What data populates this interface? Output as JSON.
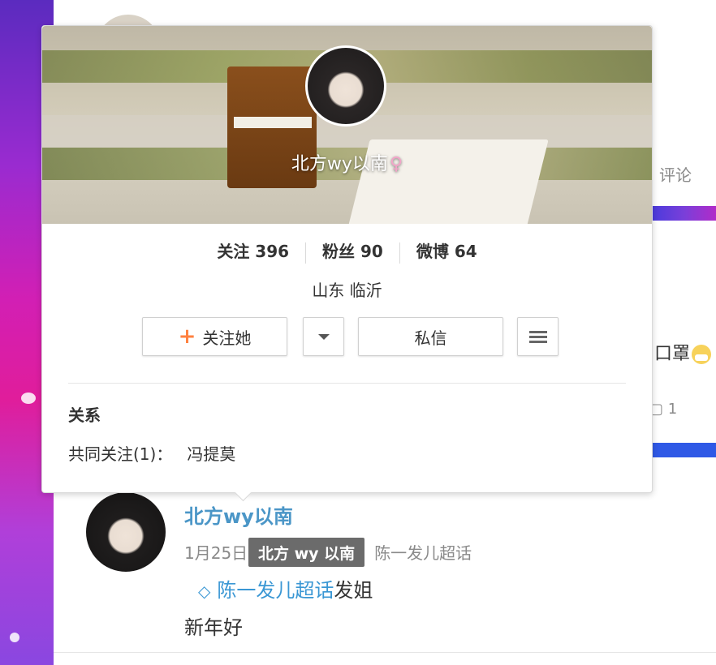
{
  "background": {
    "comment_tab": "评论",
    "mask_text": "口罩",
    "count": "1"
  },
  "card": {
    "nickname": "北方wy以南",
    "gender_icon": "♀",
    "stats": [
      {
        "label": "关注",
        "value": "396"
      },
      {
        "label": "粉丝",
        "value": "90"
      },
      {
        "label": "微博",
        "value": "64"
      }
    ],
    "location": "山东 临沂",
    "buttons": {
      "follow": "关注她",
      "message": "私信"
    },
    "relation": {
      "title": "关系",
      "mutual_label": "共同关注(1)：",
      "mutual_name": "冯提莫"
    }
  },
  "post": {
    "author": "北方wy以南",
    "date": "1月25日",
    "source": "陈一发儿超话",
    "tooltip": "北方 wy 以南",
    "topic_link": "陈一发儿超话",
    "topic_suffix": "发姐",
    "text": "新年好"
  },
  "colors": {
    "link": "#4b96c7",
    "accent_orange": "#ff8140",
    "tooltip_bg": "#6b6b6b"
  }
}
